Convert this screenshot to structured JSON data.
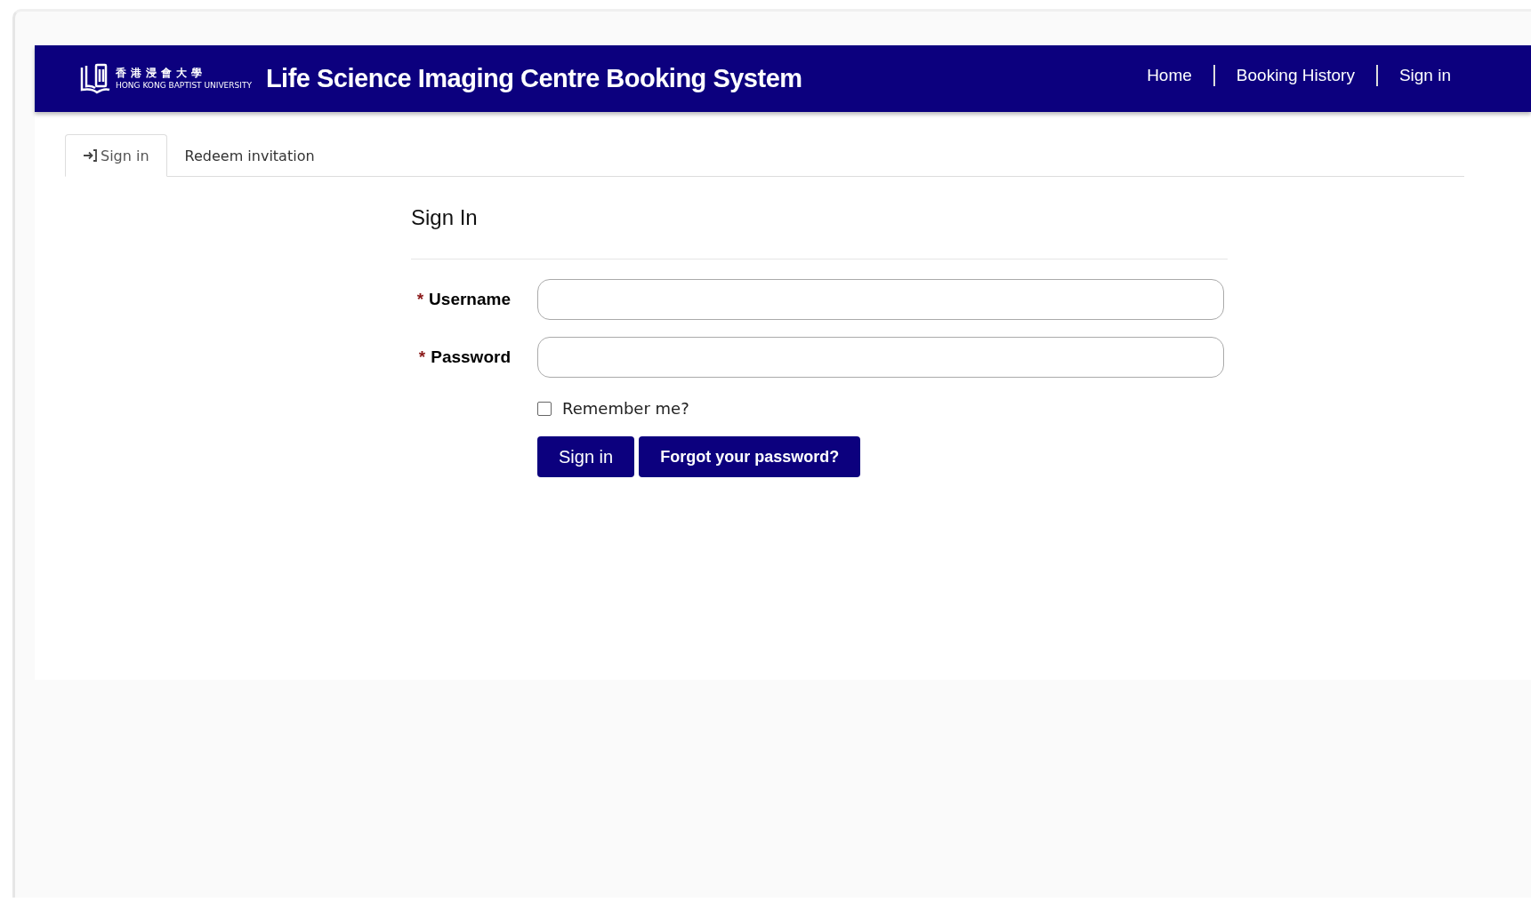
{
  "header": {
    "logo": {
      "chinese_name": "香港浸會大學",
      "english_name": "HONG KONG BAPTIST UNIVERSITY"
    },
    "title": "Life Science Imaging Centre Booking System",
    "nav": [
      "Home",
      "Booking History",
      "Sign in"
    ]
  },
  "tabs": [
    {
      "label": "Sign in",
      "selected": true,
      "kind": "icon"
    },
    {
      "label": "Redeem invitation",
      "selected": false,
      "kind": "plain"
    }
  ],
  "form": {
    "heading": "Sign In",
    "fields": [
      {
        "label": "Username",
        "required_mark": "*"
      },
      {
        "label": "Password",
        "required_mark": "*"
      }
    ],
    "remember": {
      "label": "Remember me?",
      "checked": false
    },
    "buttons": [
      "Sign in",
      "Forgot your password?"
    ]
  }
}
